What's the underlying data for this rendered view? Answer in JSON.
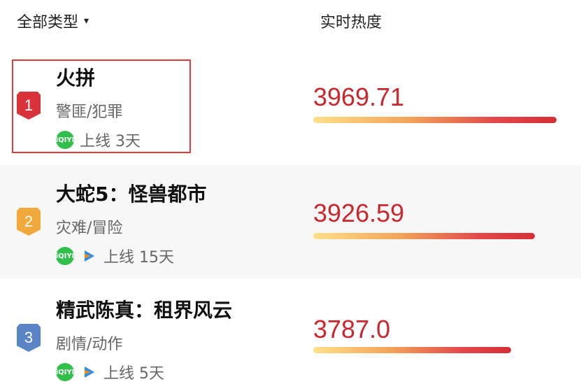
{
  "header": {
    "filter_label": "全部类型",
    "filter_caret": "▾",
    "column_title": "实时热度"
  },
  "items": [
    {
      "rank": "1",
      "rank_color": "#d8323a",
      "title": "火拼",
      "genre": "警匪/犯罪",
      "online_text": "上线 3天",
      "platforms": [
        "iqiyi-icon"
      ],
      "heat": "3969.71",
      "heat_fraction": 1.0
    },
    {
      "rank": "2",
      "rank_color": "#f2a93b",
      "title": "大蛇5：怪兽都市",
      "genre": "灾难/冒险",
      "online_text": "上线 15天",
      "platforms": [
        "iqiyi-icon",
        "tencent-video-icon"
      ],
      "heat": "3926.59",
      "heat_fraction": 0.912
    },
    {
      "rank": "3",
      "rank_color": "#5b84c7",
      "title": "精武陈真：租界风云",
      "genre": "剧情/动作",
      "online_text": "上线 5天",
      "platforms": [
        "iqiyi-icon",
        "tencent-video-icon"
      ],
      "heat": "3787.0",
      "heat_fraction": 0.815
    }
  ],
  "colors": {
    "heat_text": "#c8282d",
    "highlight_border": "#e03a3a"
  }
}
